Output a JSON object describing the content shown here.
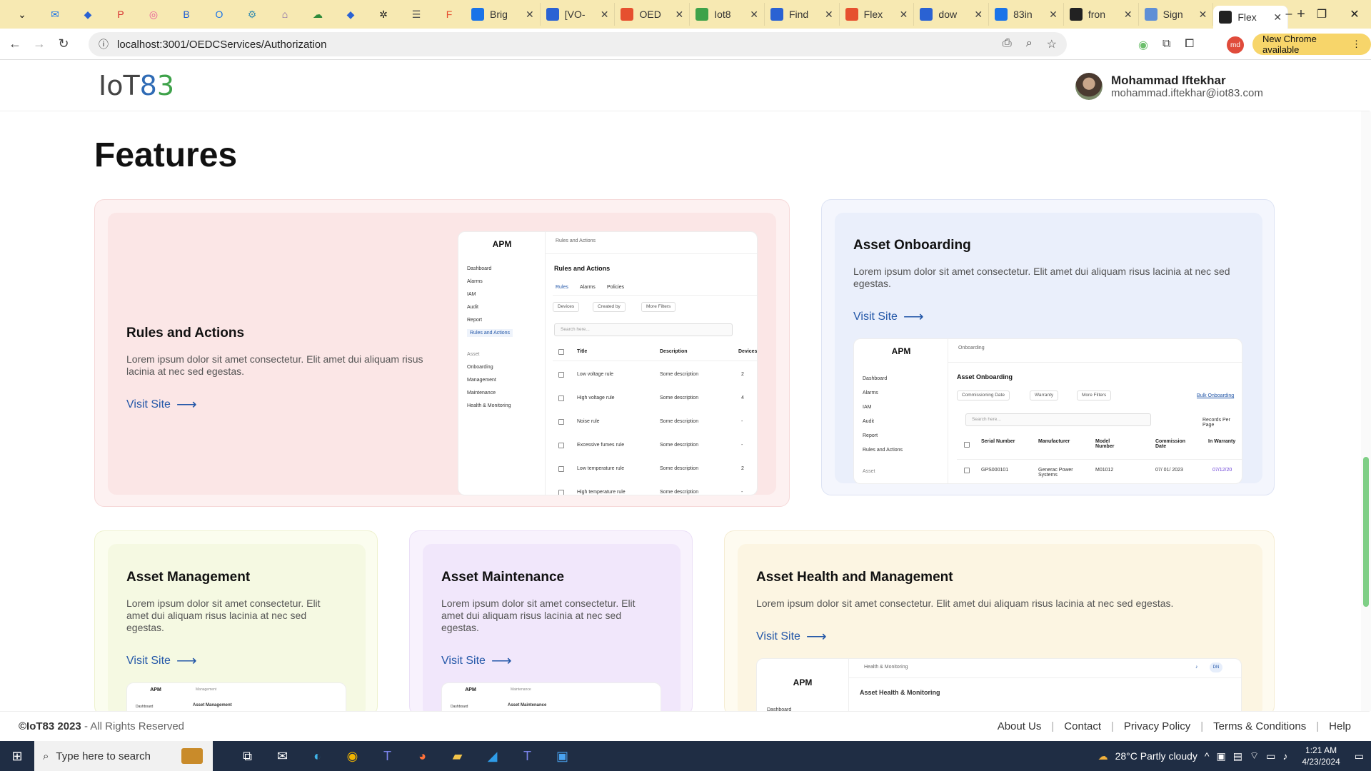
{
  "browser": {
    "tabs": [
      {
        "title": "Brig",
        "color": "#1a73e8"
      },
      {
        "title": "[VO-",
        "color": "#2a62d3"
      },
      {
        "title": "OED",
        "color": "#e6502f"
      },
      {
        "title": "Iot8",
        "color": "#3ea24a"
      },
      {
        "title": "Find",
        "color": "#2a62d3"
      },
      {
        "title": "Flex",
        "color": "#e6502f"
      },
      {
        "title": "dow",
        "color": "#2a62d3"
      },
      {
        "title": "83in",
        "color": "#1a73e8"
      },
      {
        "title": "fron",
        "color": "#222222"
      },
      {
        "title": "Sign",
        "color": "#5f8fd6"
      },
      {
        "title": "Flex",
        "color": "#222222",
        "active": true
      }
    ],
    "url": "localhost:3001/OEDCServices/Authorization",
    "profile_initials": "md",
    "update_label": "New Chrome available"
  },
  "header": {
    "logo_text": "IoT",
    "logo_8": "8",
    "logo_3": "3",
    "user_name": "Mohammad Iftekhar",
    "user_email": "mohammad.iftekhar@iot83.com"
  },
  "page": {
    "title": "Features",
    "visit_label": "Visit Site",
    "cards": {
      "rules": {
        "title": "Rules and Actions",
        "desc": "Lorem ipsum dolor sit amet consectetur. Elit amet dui aliquam risus lacinia at nec sed egestas."
      },
      "onboarding": {
        "title": "Asset Onboarding",
        "desc": "Lorem ipsum dolor sit amet consectetur. Elit amet dui aliquam risus lacinia at nec sed egestas."
      },
      "management": {
        "title": "Asset Management",
        "desc": "Lorem ipsum dolor sit amet consectetur. Elit amet dui aliquam risus lacinia at nec sed egestas."
      },
      "maintenance": {
        "title": "Asset Maintenance",
        "desc": "Lorem ipsum dolor sit amet consectetur. Elit amet dui aliquam risus lacinia at nec sed egestas."
      },
      "health": {
        "title": "Asset Health and Management",
        "desc": "Lorem ipsum dolor sit amet consectetur. Elit amet dui aliquam risus lacinia at nec sed egestas."
      }
    }
  },
  "mock_rules": {
    "apm": "APM",
    "nav": [
      "Dashboard",
      "Alarms",
      "IAM",
      "Audit",
      "Report",
      "Rules and Actions"
    ],
    "asset_label": "Asset",
    "asset_nav": [
      "Onboarding",
      "Management",
      "Maintenance",
      "Health & Monitoring"
    ],
    "crumb": "Rules and Actions",
    "heading": "Rules and Actions",
    "tabs": [
      "Rules",
      "Alarms",
      "Policies"
    ],
    "filters": [
      "Devices",
      "Created by",
      "More Filters"
    ],
    "search": "Search here...",
    "columns": [
      "Title",
      "Description",
      "Devices"
    ],
    "rows": [
      {
        "title": "Low voltage rule",
        "desc": "Some description",
        "dev": "2"
      },
      {
        "title": "High voltage rule",
        "desc": "Some description",
        "dev": "4"
      },
      {
        "title": "Noise rule",
        "desc": "Some description",
        "dev": "-"
      },
      {
        "title": "Excessive fumes rule",
        "desc": "Some description",
        "dev": "-"
      },
      {
        "title": "Low temperature rule",
        "desc": "Some description",
        "dev": "2"
      },
      {
        "title": "High temperature rule",
        "desc": "Some description",
        "dev": "-"
      }
    ]
  },
  "mock_onboarding": {
    "apm": "APM",
    "nav": [
      "Dashboard",
      "Alarms",
      "IAM",
      "Audit",
      "Report",
      "Rules and Actions"
    ],
    "asset_label": "Asset",
    "crumb": "Onboarding",
    "heading": "Asset Onboarding",
    "filters": [
      "Commissioning Date",
      "Warranty",
      "More Filters"
    ],
    "bulk": "Bulk Onboarding",
    "search": "Search here...",
    "records": "Records Per Page",
    "columns": [
      "Serial Number",
      "Manufacturer",
      "Model Number",
      "Commission Date",
      "In Warranty"
    ],
    "row": {
      "serial": "GPS000101",
      "mfr": "Generac Power Systems",
      "model": "M01012",
      "date": "07/ 01/ 2023",
      "warranty": "07/12/20"
    }
  },
  "mock_management": {
    "apm": "APM",
    "crumb": "Management",
    "nav": "Dashboard",
    "heading": "Asset Management"
  },
  "mock_maintenance": {
    "apm": "APM",
    "crumb": "Maintenance",
    "nav": "Dashboard",
    "heading": "Asset Maintenance"
  },
  "mock_health": {
    "apm": "APM",
    "crumb": "Health & Monitoring",
    "nav": "Dashboard",
    "heading": "Asset Health & Monitoring",
    "user_badge": "DN"
  },
  "footer": {
    "copyright_bold": "©IoT83 2023",
    "copyright_rest": " - All Rights Reserved",
    "links": [
      "About Us",
      "Contact",
      "Privacy Policy",
      "Terms & Conditions",
      "Help"
    ]
  },
  "taskbar": {
    "search_placeholder": "Type here to search",
    "weather": "28°C  Partly cloudy",
    "time": "1:21 AM",
    "date": "4/23/2024"
  }
}
